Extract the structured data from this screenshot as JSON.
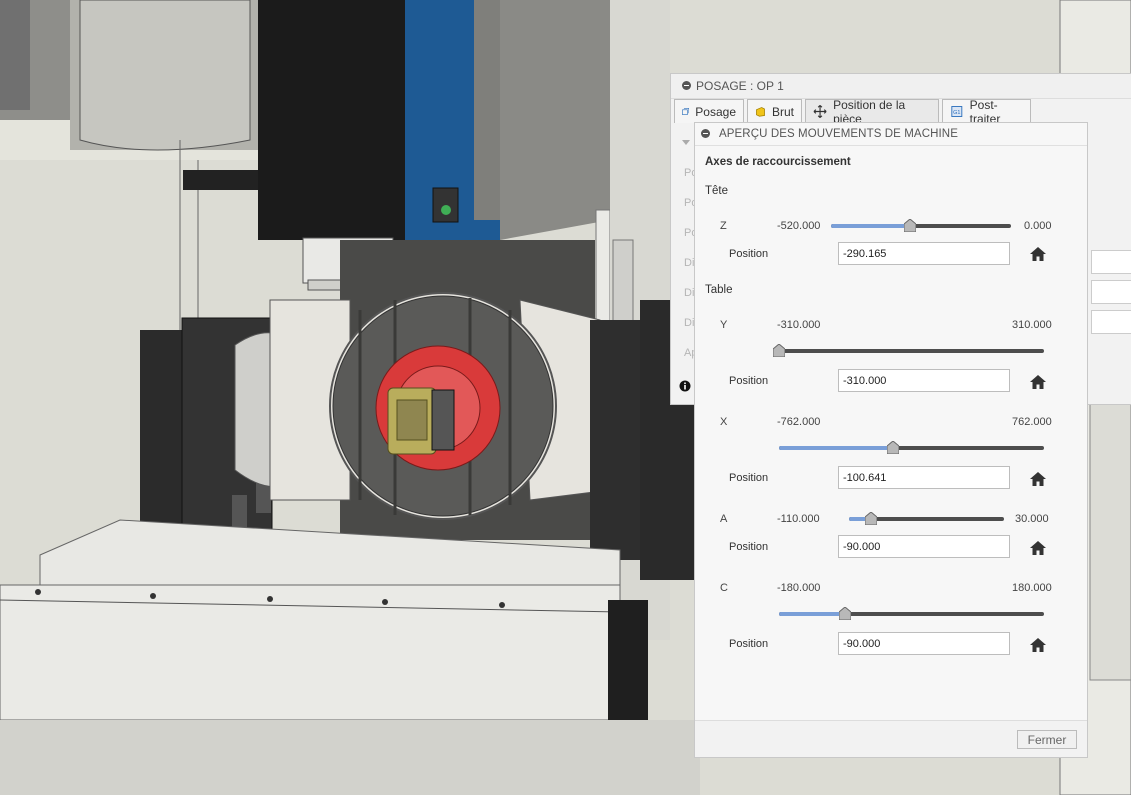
{
  "posage_dialog": {
    "title": "POSAGE : OP 1",
    "tabs": [
      {
        "label": "Posage",
        "icon": "setup-icon"
      },
      {
        "label": "Brut",
        "icon": "stock-icon"
      },
      {
        "label": "Position de la pièce",
        "icon": "move-icon"
      },
      {
        "label": "Post-traiter",
        "icon": "post-process-icon"
      }
    ],
    "partial_labels": [
      "Po",
      "Po",
      "Po",
      "Di",
      "Di",
      "Di",
      "Ap"
    ]
  },
  "apercu_dialog": {
    "title": "APERÇU DES MOUVEMENTS DE MACHINE",
    "section_title": "Axes de raccourcissement",
    "head_label": "Tête",
    "table_label": "Table",
    "position_label": "Position",
    "axes": [
      {
        "name": "Z",
        "min": "-520.000",
        "max": "0.000",
        "position": "-290.165",
        "level": 0.44
      },
      {
        "name": "Y",
        "min": "-310.000",
        "max": "310.000",
        "position": "-310.000",
        "level": 0.0
      },
      {
        "name": "X",
        "min": "-762.000",
        "max": "762.000",
        "position": "-100.641",
        "level": 0.43
      },
      {
        "name": "A",
        "min": "-110.000",
        "max": "30.000",
        "position": "-90.000",
        "level": 0.14
      },
      {
        "name": "C",
        "min": "-180.000",
        "max": "180.000",
        "position": "-90.000",
        "level": 0.25
      }
    ],
    "close_label": "Fermer"
  },
  "colors": {
    "slider_fill": "#7a9fd8",
    "slider_track": "#4d4d4d",
    "spindle_blue": "#1e5a94",
    "rotary_red": "#d93a3a"
  }
}
